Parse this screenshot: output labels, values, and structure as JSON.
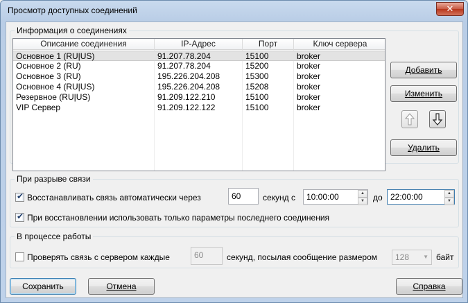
{
  "window": {
    "title": "Просмотр доступных соединений"
  },
  "connections": {
    "group_label": "Информация о соединениях",
    "columns": [
      "Описание соединения",
      "IP-Адрес",
      "Порт",
      "Ключ сервера"
    ],
    "rows": [
      [
        "Основное 1 (RU|US)",
        "91.207.78.204",
        "15100",
        "broker"
      ],
      [
        "Основное 2 (RU)",
        "91.207.78.204",
        "15200",
        "broker"
      ],
      [
        "Основное 3 (RU)",
        "195.226.204.208",
        "15300",
        "broker"
      ],
      [
        "Основное 4 (RU|US)",
        "195.226.204.208",
        "15208",
        "broker"
      ],
      [
        "Резервное (RU|US)",
        "91.209.122.210",
        "15100",
        "broker"
      ],
      [
        "VIP Сервер",
        "91.209.122.122",
        "15100",
        "broker"
      ]
    ],
    "selected_row": 0,
    "buttons": {
      "add": "Добавить",
      "edit": "Изменить",
      "delete": "Удалить"
    }
  },
  "reconnect": {
    "group_label": "При разрыве связи",
    "auto_label": "Восстанавливать связь автоматически через",
    "auto_checked": true,
    "seconds_value": "60",
    "seconds_from_label": "секунд с",
    "from_time": "10:00:00",
    "to_label": "до",
    "to_time": "22:00:00",
    "last_params_label": "При восстановлении использовать только параметры последнего соединения",
    "last_params_checked": true
  },
  "working": {
    "group_label": "В процессе работы",
    "check_label": "Проверять связь с сервером каждые",
    "check_checked": false,
    "interval_value": "60",
    "middle_label": "секунд, посылая сообщение размером",
    "size_value": "128",
    "unit_label": "байт"
  },
  "footer": {
    "save": "Сохранить",
    "cancel": "Отмена",
    "help": "Справка"
  }
}
